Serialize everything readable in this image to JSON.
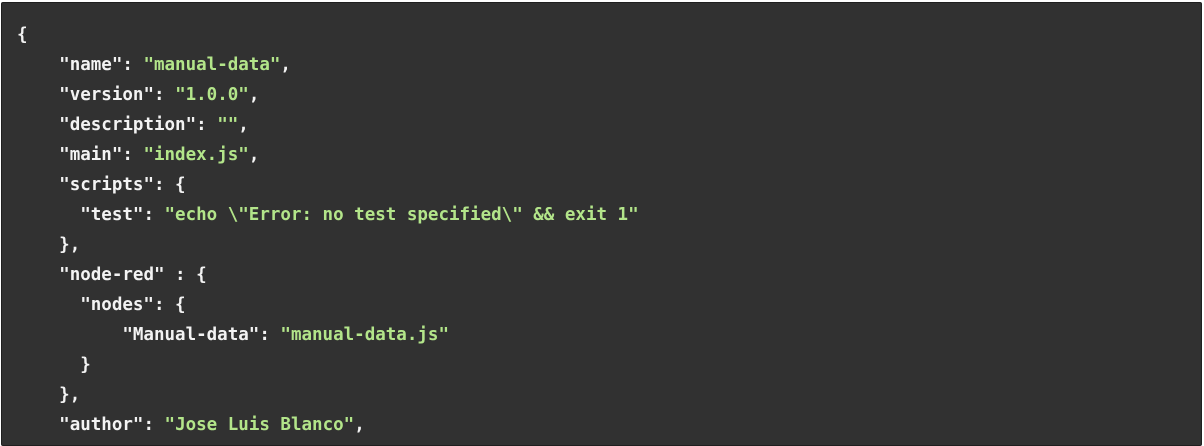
{
  "colors": {
    "background": "#313131",
    "text": "#f3f3f3",
    "string": "#b3e58a"
  },
  "code": {
    "language": "json",
    "lines": [
      {
        "indent": "",
        "parts": [
          {
            "t": "punc",
            "v": "{"
          }
        ]
      },
      {
        "indent": "    ",
        "parts": [
          {
            "t": "key",
            "v": "\"name\""
          },
          {
            "t": "punc",
            "v": ": "
          },
          {
            "t": "str",
            "v": "\"manual-data\""
          },
          {
            "t": "punc",
            "v": ","
          }
        ]
      },
      {
        "indent": "    ",
        "parts": [
          {
            "t": "key",
            "v": "\"version\""
          },
          {
            "t": "punc",
            "v": ": "
          },
          {
            "t": "str",
            "v": "\"1.0.0\""
          },
          {
            "t": "punc",
            "v": ","
          }
        ]
      },
      {
        "indent": "    ",
        "parts": [
          {
            "t": "key",
            "v": "\"description\""
          },
          {
            "t": "punc",
            "v": ": "
          },
          {
            "t": "str",
            "v": "\"\""
          },
          {
            "t": "punc",
            "v": ","
          }
        ]
      },
      {
        "indent": "    ",
        "parts": [
          {
            "t": "key",
            "v": "\"main\""
          },
          {
            "t": "punc",
            "v": ": "
          },
          {
            "t": "str",
            "v": "\"index.js\""
          },
          {
            "t": "punc",
            "v": ","
          }
        ]
      },
      {
        "indent": "    ",
        "parts": [
          {
            "t": "key",
            "v": "\"scripts\""
          },
          {
            "t": "punc",
            "v": ": {"
          }
        ]
      },
      {
        "indent": "      ",
        "parts": [
          {
            "t": "key",
            "v": "\"test\""
          },
          {
            "t": "punc",
            "v": ": "
          },
          {
            "t": "str",
            "v": "\"echo \\\"Error: no test specified\\\" && exit 1\""
          }
        ]
      },
      {
        "indent": "    ",
        "parts": [
          {
            "t": "punc",
            "v": "},"
          }
        ]
      },
      {
        "indent": "    ",
        "parts": [
          {
            "t": "key",
            "v": "\"node-red\""
          },
          {
            "t": "punc",
            "v": " : {"
          }
        ]
      },
      {
        "indent": "      ",
        "parts": [
          {
            "t": "key",
            "v": "\"nodes\""
          },
          {
            "t": "punc",
            "v": ": {"
          }
        ]
      },
      {
        "indent": "          ",
        "parts": [
          {
            "t": "key",
            "v": "\"Manual-data\""
          },
          {
            "t": "punc",
            "v": ": "
          },
          {
            "t": "str",
            "v": "\"manual-data.js\""
          }
        ]
      },
      {
        "indent": "      ",
        "parts": [
          {
            "t": "punc",
            "v": "}"
          }
        ]
      },
      {
        "indent": "    ",
        "parts": [
          {
            "t": "punc",
            "v": "},"
          }
        ]
      },
      {
        "indent": "    ",
        "parts": [
          {
            "t": "key",
            "v": "\"author\""
          },
          {
            "t": "punc",
            "v": ": "
          },
          {
            "t": "str",
            "v": "\"Jose Luis Blanco\""
          },
          {
            "t": "punc",
            "v": ","
          }
        ]
      }
    ]
  }
}
